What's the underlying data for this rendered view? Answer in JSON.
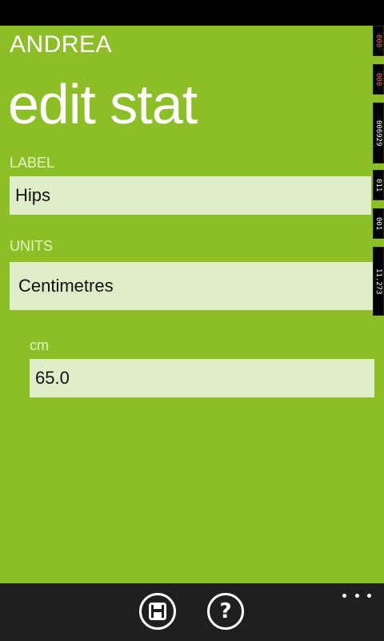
{
  "header": {
    "app_title": "ANDREA",
    "page_title": "edit stat"
  },
  "form": {
    "label_field": {
      "caption": "LABEL",
      "value": "Hips"
    },
    "units_field": {
      "caption": "UNITS",
      "value": "Centimetres"
    },
    "measurement_field": {
      "caption": "cm",
      "value": "65.0"
    }
  },
  "debug_counters": [
    "000",
    "000",
    "006929",
    "011",
    "001",
    "11.273"
  ],
  "app_bar": {
    "save_icon": "save-disk-icon",
    "help_icon": "question-icon",
    "more_icon": "ellipsis-icon",
    "help_glyph": "?"
  },
  "colors": {
    "accent_background": "#8cbf26",
    "field_background": "#dfeec8",
    "app_bar_background": "#1f1f1f"
  }
}
